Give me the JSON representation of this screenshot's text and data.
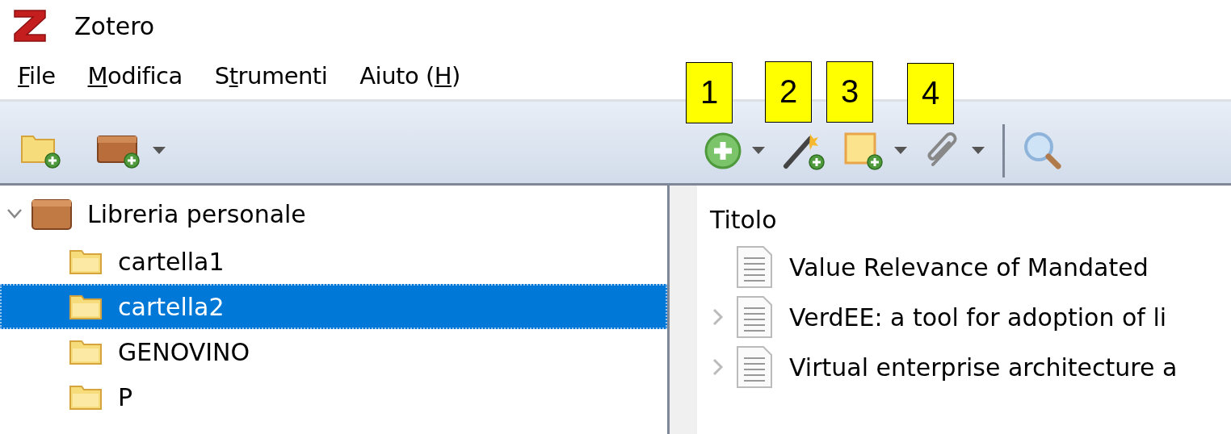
{
  "window": {
    "title": "Zotero"
  },
  "menu": [
    {
      "key": "F",
      "after": "ile"
    },
    {
      "key": "M",
      "after": "odifica"
    },
    {
      "before": "S",
      "key": "t",
      "after": "rumenti"
    },
    {
      "before": "Aiuto (",
      "key": "H",
      "after": ")"
    }
  ],
  "toolbar": {
    "left": [
      {
        "kind": "new-collection",
        "dropdown": false
      },
      {
        "kind": "new-library",
        "dropdown": true
      }
    ],
    "right": [
      {
        "kind": "new-item",
        "dropdown": true,
        "badge": "1"
      },
      {
        "kind": "add-by-identifier",
        "dropdown": false,
        "badge": "2"
      },
      {
        "kind": "new-note",
        "dropdown": true,
        "badge": "3"
      },
      {
        "kind": "add-attachment",
        "dropdown": true,
        "badge": "4"
      },
      {
        "kind": "separator"
      },
      {
        "kind": "search",
        "dropdown": false
      }
    ]
  },
  "collections": [
    {
      "label": "Libreria personale",
      "kind": "library",
      "expanded": true,
      "selected": false,
      "children": [
        {
          "label": "cartella1",
          "kind": "folder",
          "selected": false
        },
        {
          "label": "cartella2",
          "kind": "folder",
          "selected": true
        },
        {
          "label": "GENOVINO",
          "kind": "folder",
          "selected": false
        },
        {
          "label": "P",
          "kind": "folder",
          "selected": false
        }
      ]
    }
  ],
  "items": {
    "columns": [
      "Titolo"
    ],
    "rows": [
      {
        "title": "Value Relevance of Mandated",
        "expandable": false
      },
      {
        "title": "VerdEE: a tool for adoption of li",
        "expandable": true
      },
      {
        "title": "Virtual enterprise architecture a",
        "expandable": true
      }
    ]
  }
}
